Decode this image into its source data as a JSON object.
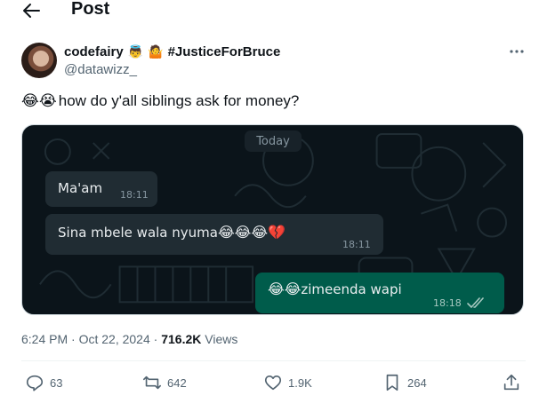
{
  "header": {
    "title": "Post",
    "back_icon": "arrow-left-icon"
  },
  "author": {
    "display_name": "codefairy",
    "badges": [
      "👼",
      "🤷"
    ],
    "hashtag": "#JusticeForBruce",
    "handle": "@datawizz_",
    "avatar_icon": "avatar-photo"
  },
  "tweet": {
    "lead_emojis": "😂😭",
    "text": "how do y'all siblings ask for money?"
  },
  "chat": {
    "date_chip": "Today",
    "messages": [
      {
        "direction": "incoming",
        "text": "Ma'am",
        "time": "18:11"
      },
      {
        "direction": "incoming",
        "text": "Sina mbele wala nyuma",
        "emojis": "😂😂😂💔",
        "time": "18:11"
      },
      {
        "direction": "outgoing",
        "emojis": "😂😂",
        "text": "zimeenda wapi",
        "time": "18:18",
        "status_icon": "double-check-icon"
      }
    ],
    "colors": {
      "background": "#0b141a",
      "incoming": "#202c33",
      "outgoing": "#005c4b"
    }
  },
  "meta": {
    "time": "6:24 PM",
    "separator": " · ",
    "date": "Oct 22, 2024",
    "views_count": "716.2K",
    "views_label": " Views"
  },
  "actions": {
    "replies": "63",
    "reposts": "642",
    "likes": "1.9K",
    "bookmarks": "264"
  }
}
